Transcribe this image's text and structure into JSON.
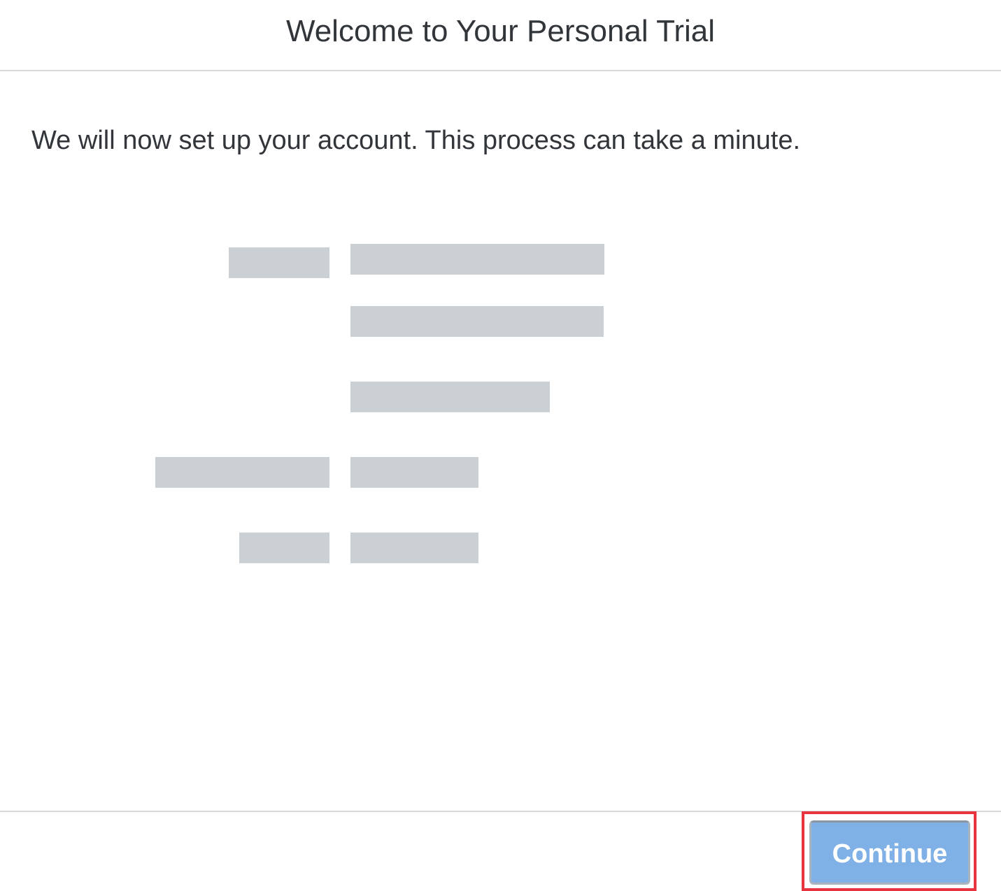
{
  "dialog": {
    "title": "Welcome to Your Personal Trial",
    "message": "We will now set up your account. This process can take a minute.",
    "continue_label": "Continue"
  },
  "colors": {
    "text": "#32363a",
    "divider": "#d9d9d9",
    "redaction": "#cbd0d5",
    "button_bg": "#7fb0e6",
    "button_text": "#ffffff",
    "highlight": "#e8343f"
  }
}
